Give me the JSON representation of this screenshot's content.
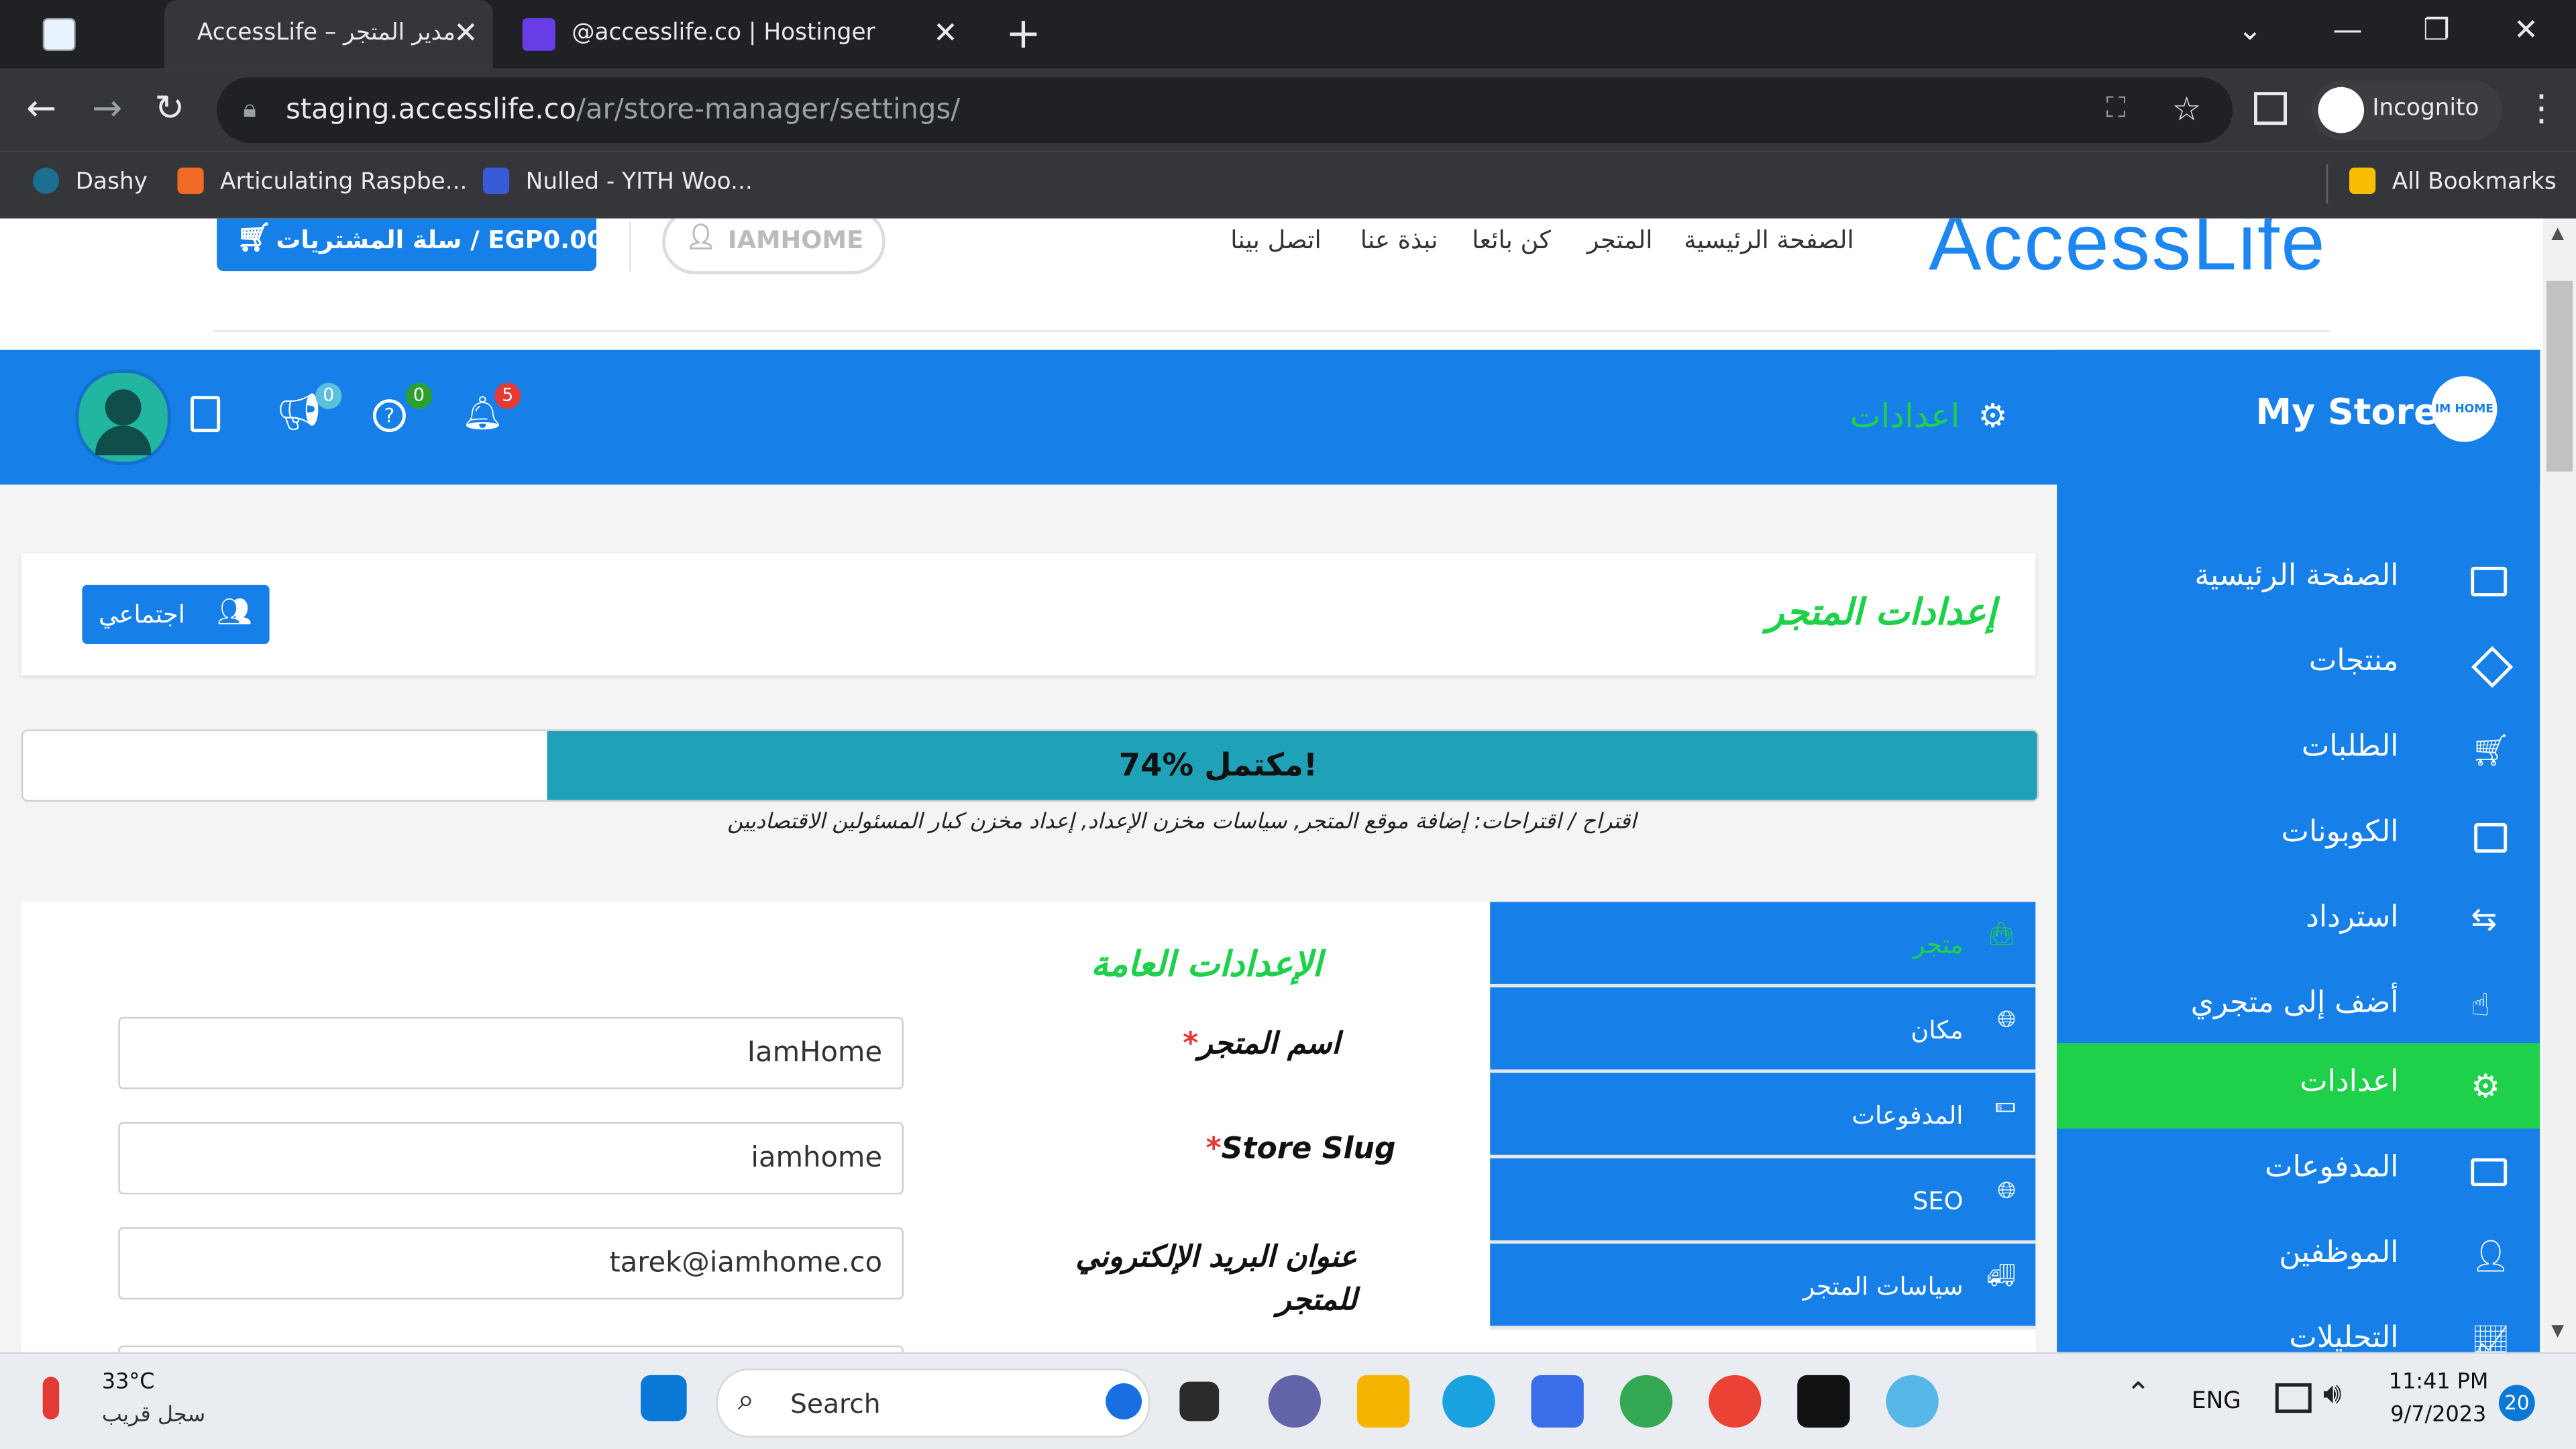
{
  "browser": {
    "tabs": [
      {
        "title": "AccessLife – مدير المتجر",
        "active": true
      },
      {
        "title": "@accesslife.co | Hostinger",
        "active": false
      }
    ],
    "url_host": "staging.accesslife.co",
    "url_path": "/ar/store-manager/settings/",
    "profile_label": "Incognito",
    "bookmarks": [
      "Dashy",
      "Articulating Raspbe...",
      "Nulled - YITH Woo..."
    ],
    "all_bookmarks": "All Bookmarks"
  },
  "site": {
    "logo": "AccessLife",
    "cart_label": "سلة المشتريات / EGP0.00",
    "user_label": "IAMHOME",
    "nav": [
      "الصفحة الرئيسية",
      "المتجر",
      "كن بائعا",
      "نبذة عنا",
      "اتصل بينا"
    ]
  },
  "store_header": {
    "title": "اعدادات",
    "badges": {
      "bell": "5",
      "help": "0",
      "announce": "0"
    }
  },
  "sidebar": {
    "store_name": "My Store",
    "store_logo_text": "IM HOME",
    "items": [
      {
        "label": "الصفحة الرئيسية",
        "icon": "monitor-icon"
      },
      {
        "label": "منتجات",
        "icon": "cube-icon"
      },
      {
        "label": "الطلبات",
        "icon": "cart-icon"
      },
      {
        "label": "الكوبونات",
        "icon": "gift-icon"
      },
      {
        "label": "استرداد",
        "icon": "refund-icon"
      },
      {
        "label": "أضف إلى متجري",
        "icon": "hand-pointer-icon"
      },
      {
        "label": "اعدادات",
        "icon": "gears-icon",
        "active": true
      },
      {
        "label": "المدفوعات",
        "icon": "credit-card-icon"
      },
      {
        "label": "الموظفين",
        "icon": "user-icon"
      },
      {
        "label": "التحليلات",
        "icon": "chart-icon"
      }
    ]
  },
  "settings": {
    "page_title": "إعدادات المتجر",
    "social_button": "اجتماعي",
    "progress_percent": 74,
    "progress_text": "74% مكتمل!",
    "suggestion": "اقتراح / اقتراحات: إضافة موقع المتجر, سياسات مخزن الإعداد, إعداد مخزن كبار المسئولين الاقتصاديين",
    "tabs": [
      {
        "label": "متجر",
        "icon": "bag-icon",
        "active": true
      },
      {
        "label": "مكان",
        "icon": "globe-icon"
      },
      {
        "label": "المدفوعات",
        "icon": "money-icon"
      },
      {
        "label": "SEO",
        "icon": "globe-icon"
      },
      {
        "label": "سياسات المتجر",
        "icon": "truck-icon"
      }
    ],
    "section_title": "الإعدادات العامة",
    "fields": [
      {
        "label": "اسم المتجر",
        "required": "*",
        "value": "IamHome"
      },
      {
        "label": "Store Slug",
        "required": "*",
        "value": "iamhome"
      },
      {
        "label": "عنوان البريد الإلكتروني للمتجر",
        "value": "tarek@iamhome.co"
      }
    ]
  },
  "taskbar": {
    "weather_temp": "33°C",
    "weather_desc": "سجل قريب",
    "search_placeholder": "Search",
    "lang": "ENG",
    "time": "11:41 PM",
    "date": "9/7/2023",
    "notification_count": "20"
  },
  "colors": {
    "accent_blue": "#1680e8",
    "accent_green": "#1fd14a",
    "progress_teal": "#1fa2b8"
  }
}
